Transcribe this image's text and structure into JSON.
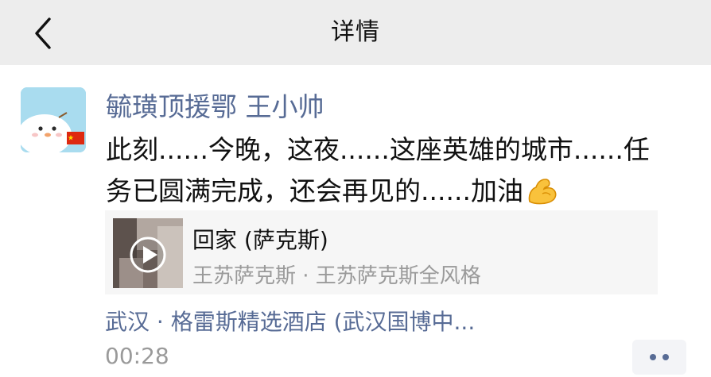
{
  "header": {
    "title": "详情",
    "back_icon": "chevron-left-icon"
  },
  "post": {
    "avatar_icon": "cartoon-bird-avatar",
    "username": "毓璜顶援鄂 王小帅",
    "text_line1": "此刻......今晚，这夜......这座英雄的城市......任",
    "text_line2": "务已圆满完成，还会再见的......加油",
    "text_emoji": "flexed-biceps-emoji"
  },
  "music": {
    "title": "回家 (萨克斯)",
    "subtitle": "王苏萨克斯 · 王苏萨克斯全风格",
    "play_icon": "play-icon"
  },
  "location": "武汉 · 格雷斯精选酒店 (武汉国博中...",
  "time": "00:28",
  "more_icon": "more-dots-icon",
  "colors": {
    "nav_bg": "#ededed",
    "link": "#576b95",
    "text": "#111111",
    "secondary": "#9a9a9a",
    "card_bg": "#f6f6f6"
  }
}
